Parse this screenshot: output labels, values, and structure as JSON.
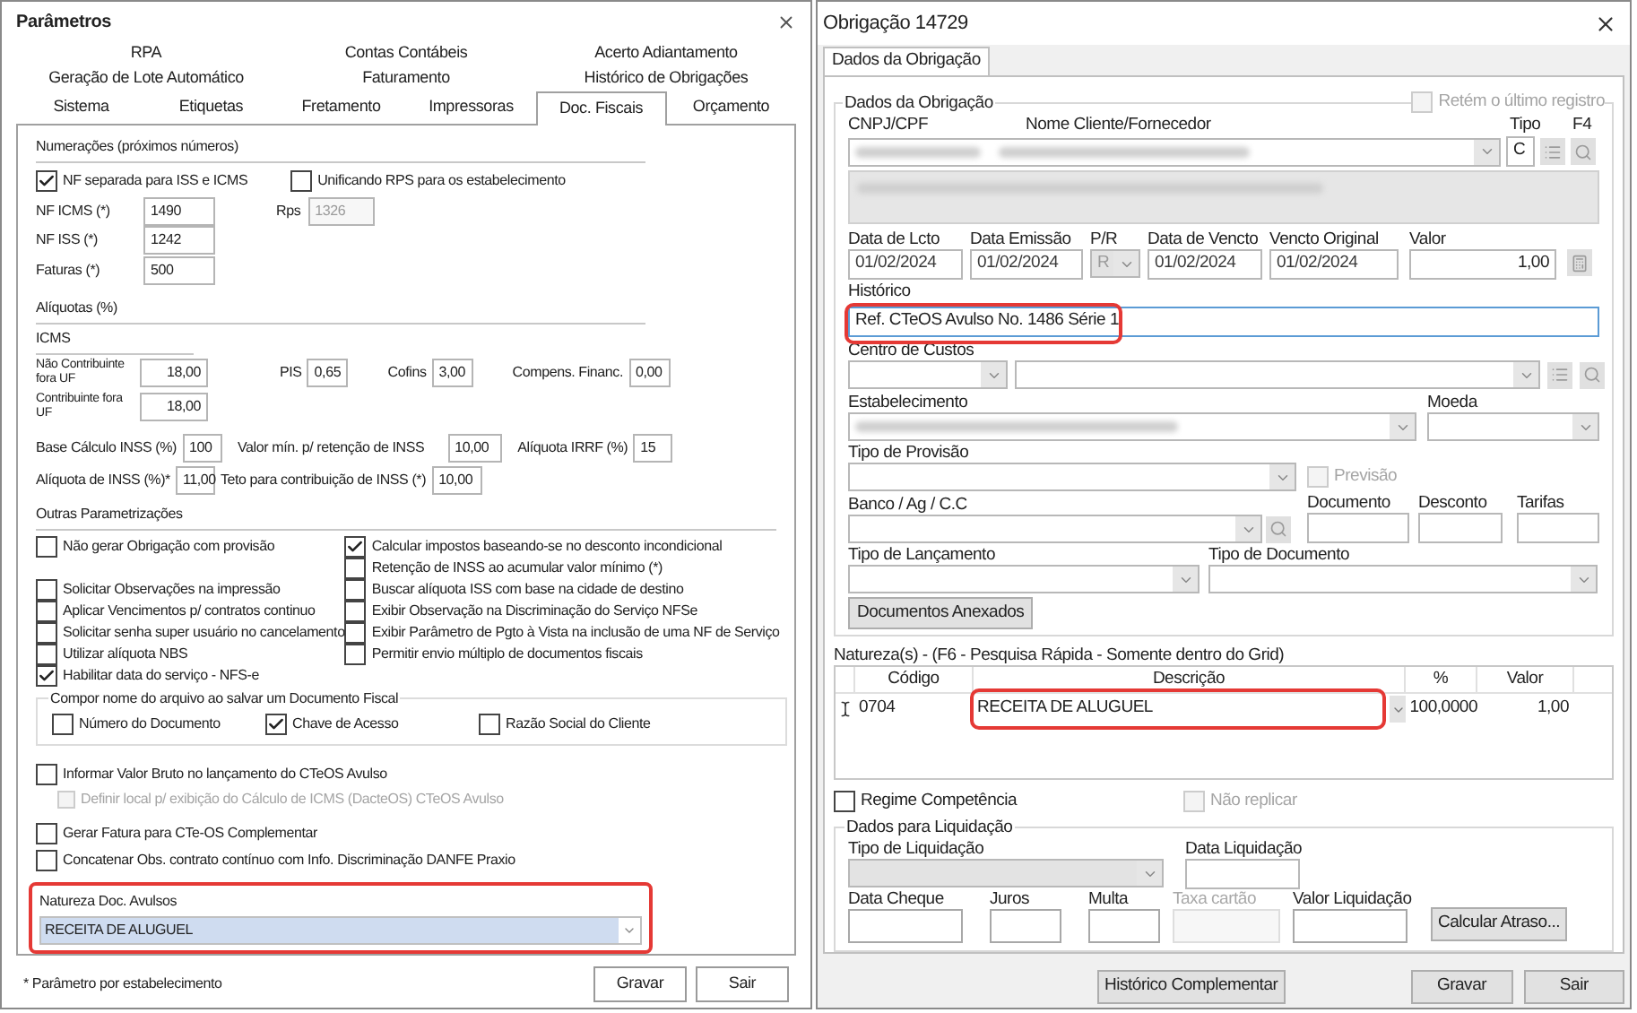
{
  "parametros": {
    "title": "Parâmetros",
    "tab_rows": [
      [
        {
          "label": "RPA",
          "selected": false
        },
        {
          "label": "Contas Contábeis",
          "selected": false
        },
        {
          "label": "Acerto Adiantamento",
          "selected": false
        }
      ],
      [
        {
          "label": "Geração de Lote Automático",
          "selected": false
        },
        {
          "label": "Faturamento",
          "selected": false
        },
        {
          "label": "Histórico de Obrigações",
          "selected": false
        }
      ],
      [
        {
          "label": "Sistema",
          "selected": false
        },
        {
          "label": "Etiquetas",
          "selected": false
        },
        {
          "label": "Fretamento",
          "selected": false
        },
        {
          "label": "Impressoras",
          "selected": false
        },
        {
          "label": "Doc. Fiscais",
          "selected": true
        },
        {
          "label": "Orçamento",
          "selected": false
        }
      ]
    ],
    "numeracoes": {
      "title": "Numerações (próximos números)",
      "options": [
        {
          "label": "NF separada para ISS e ICMS",
          "checked": true
        },
        {
          "label": "Unificando RPS para os estabelecimento",
          "checked": false
        }
      ],
      "fields": [
        {
          "label": "NF ICMS (*)",
          "value": "1490"
        },
        {
          "label": "NF ISS (*)",
          "value": "1242"
        },
        {
          "label": "Faturas (*)",
          "value": "500"
        }
      ],
      "rps": {
        "label": "Rps",
        "value": "1326",
        "disabled": true
      }
    },
    "aliquotas": {
      "title": "Alíquotas (%)",
      "icms_title": "ICMS",
      "icms": [
        {
          "label": "Não Contribuinte fora UF",
          "value": "18,00"
        },
        {
          "label": "Contribuinte fora UF",
          "value": "18,00"
        }
      ],
      "taxes": [
        {
          "label": "PIS",
          "value": "0,65"
        },
        {
          "label": "Cofins",
          "value": "3,00"
        },
        {
          "label": "Compens. Financ.",
          "value": "0,00"
        }
      ],
      "inss_row": [
        {
          "label": "Base Cálculo INSS (%)",
          "value": "100"
        },
        {
          "label": "Valor mín. p/ retenção de INSS",
          "value": "10,00"
        },
        {
          "label": "Alíquota IRRF (%)",
          "value": "15"
        }
      ],
      "inss_row_2": [
        {
          "label": "Alíquota de INSS (%)*",
          "value": "11,00"
        },
        {
          "label": "Teto para contribuição de INSS (*)",
          "value": "10,00"
        }
      ]
    },
    "outras": {
      "title": "Outras Parametrizações",
      "left": [
        {
          "label": "Não gerar Obrigação com provisão",
          "checked": false
        },
        {
          "label": "Solicitar Observações na impressão",
          "checked": false
        },
        {
          "label": "Aplicar Vencimentos p/ contratos continuo",
          "checked": false
        },
        {
          "label": "Solicitar senha super usuário no cancelamento",
          "checked": false
        },
        {
          "label": "Utilizar alíquota NBS",
          "checked": false
        }
      ],
      "right": [
        {
          "label": "Calcular impostos baseando-se no desconto incondicional",
          "checked": true
        },
        {
          "label": "Retenção de INSS ao acumular valor mínimo (*)",
          "checked": false
        },
        {
          "label": "Buscar alíquota ISS com base na cidade de destino",
          "checked": false
        },
        {
          "label": "Exibir Observação na Discriminação do Serviço NFSe",
          "checked": false
        },
        {
          "label": "Exibir Parâmetro de Pgto à Vista na inclusão de uma NF de Serviço",
          "checked": false
        },
        {
          "label": "Permitir envio múltiplo de documentos fiscais",
          "checked": false
        }
      ],
      "after": [
        {
          "label": "Habilitar data do serviço - NFS-e",
          "checked": true
        }
      ]
    },
    "compor": {
      "title": "Compor nome do arquivo ao salvar um Documento Fiscal",
      "options": [
        {
          "label": "Número do Documento",
          "checked": false
        },
        {
          "label": "Chave de Acesso",
          "checked": true
        },
        {
          "label": "Razão Social do Cliente",
          "checked": false
        }
      ]
    },
    "more": [
      {
        "label": "Informar Valor Bruto no lançamento do CTeOS Avulso",
        "checked": false,
        "children": [
          {
            "label": "Definir local p/ exibição do Cálculo de ICMS (DacteOS) CTeOS Avulso",
            "checked": false,
            "disabled": true
          }
        ]
      },
      {
        "label": "Gerar Fatura para CTe-OS Complementar",
        "checked": false
      },
      {
        "label": "Concatenar Obs. contrato contínuo com Info. Discriminação DANFE Praxio",
        "checked": false
      }
    ],
    "natureza": {
      "label": "Natureza Doc. Avulsos",
      "value": "RECEITA DE ALUGUEL",
      "highlighted": true
    },
    "footnote": "* Parâmetro por estabelecimento",
    "buttons": [
      "Gravar",
      "Sair"
    ]
  },
  "obrigacao": {
    "title": "Obrigação 14729",
    "tabs": [
      {
        "label": "Dados da Obrigação",
        "selected": true
      }
    ],
    "group_title": "Dados da Obrigação",
    "retem": {
      "label": "Retém o último registro",
      "checked": false,
      "disabled": true
    },
    "labels": {
      "cnpj": "CNPJ/CPF",
      "nome": "Nome Cliente/Fornecedor",
      "tipo": "Tipo",
      "f4": "F4"
    },
    "tipo_value": "C",
    "dates": [
      {
        "label": "Data de Lcto",
        "value": "01/02/2024",
        "kind": "date"
      },
      {
        "label": "Data Emissão",
        "value": "01/02/2024",
        "kind": "date"
      },
      {
        "label": "P/R",
        "value": "R",
        "kind": "combo"
      },
      {
        "label": "Data de Vencto",
        "value": "01/02/2024",
        "kind": "date"
      },
      {
        "label": "Vencto Original",
        "value": "01/02/2024",
        "kind": "date"
      },
      {
        "label": "Valor",
        "value": "1,00",
        "kind": "amount"
      }
    ],
    "historico": {
      "label": "Histórico",
      "value": "Ref. CTeOS Avulso No. 1486 Série 1",
      "highlighted": true
    },
    "centro_custos": "Centro de Custos",
    "estabelecimento": "Estabelecimento",
    "moeda": "Moeda",
    "tipo_provisao": "Tipo de Provisão",
    "previsao": {
      "label": "Previsão",
      "checked": false,
      "disabled": true
    },
    "banco": "Banco / Ag / C.C",
    "extra_fields": [
      "Documento",
      "Desconto",
      "Tarifas"
    ],
    "tipo_lancamento": "Tipo de Lançamento",
    "tipo_documento": "Tipo de Documento",
    "anexos_button": "Documentos Anexados",
    "naturezas": {
      "title": "Natureza(s) - (F6 - Pesquisa Rápida - Somente dentro do Grid)",
      "columns": [
        "Código",
        "Descrição",
        "%",
        "Valor"
      ],
      "rows": [
        {
          "codigo": "0704",
          "descricao": "RECEITA DE ALUGUEL",
          "percent": "100,0000",
          "valor": "1,00",
          "highlighted": true
        }
      ]
    },
    "regime": {
      "label": "Regime Competência",
      "checked": false,
      "disabled": false
    },
    "nao_replicar": {
      "label": "Não replicar",
      "checked": false,
      "disabled": true
    },
    "liquidacao": {
      "title": "Dados para Liquidação",
      "tipo": "Tipo de Liquidação",
      "data": "Data Liquidação",
      "fields": [
        {
          "label": "Data Cheque",
          "disabled": false
        },
        {
          "label": "Juros",
          "disabled": false
        },
        {
          "label": "Multa",
          "disabled": false
        },
        {
          "label": "Taxa cartão",
          "disabled": true
        },
        {
          "label": "Valor Liquidação",
          "disabled": false
        }
      ],
      "button": "Calcular Atraso..."
    },
    "footer_buttons": [
      "Histórico Complementar",
      "Gravar",
      "Sair"
    ]
  }
}
